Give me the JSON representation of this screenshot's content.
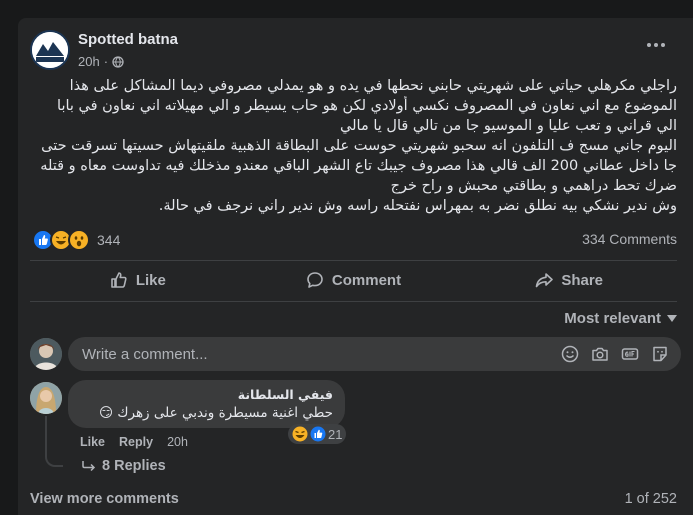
{
  "post": {
    "page_name": "Spotted batna",
    "time": "20h",
    "avatar_text": "Spotted Batna",
    "lines": [
      "راجلي مكرهلي حياتي على شهريتي حابني نحطها في يده و هو يمدلي مصروفي ديما المشاكل على هذا",
      "الموضوع مع اني نعاون في المصروف نكسي أولادي لكن هو حاب يسيطر و الي مهيلاته اني نعاون في بابا",
      "الي قراني و تعب عليا و الموسيو جا من تالي قال يا مالي",
      "اليوم جاني مسج ف التلفون انه سحبو شهريتي حوست على البطاقة الذهبية ملقيتهاش حسيتها تسرقت حتى",
      "جا داخل عطاني 200 الف قالي هذا مصروف جيبك تاع الشهر الباقي معندو مذخلك فيه تداوست معاه و قتله",
      "ضرك تحط دراهمي و بطاقتي محبش و راح خرج",
      "وش ندير نشكي بيه نطلق نضر به بمهراس نفتحله راسه وش ندير راني نرجف في حالة."
    ],
    "reaction_count": "344",
    "comments_count": "334 Comments",
    "reactions": [
      "like",
      "haha",
      "wow"
    ]
  },
  "actions": {
    "like": "Like",
    "comment": "Comment",
    "share": "Share"
  },
  "sort_label": "Most relevant",
  "comment_input": {
    "placeholder": "Write a comment..."
  },
  "comment": {
    "author": "فيفي السلطانة",
    "text": "حطي اغنية مسيطرة وندبي على زهرك 😏",
    "like_label": "Like",
    "reply_label": "Reply",
    "time": "20h",
    "reaction_count": "21",
    "replies_label": "8 Replies"
  },
  "footer": {
    "view_more": "View more comments",
    "pager": "1 of 252"
  },
  "colors": {
    "background": "#18191a",
    "card": "#242526",
    "input": "#3a3b3c",
    "text": "#e4e6eb",
    "secondary": "#b0b3b8",
    "like_blue": "#1877f2",
    "emoji_yellow": "#f7b125"
  }
}
